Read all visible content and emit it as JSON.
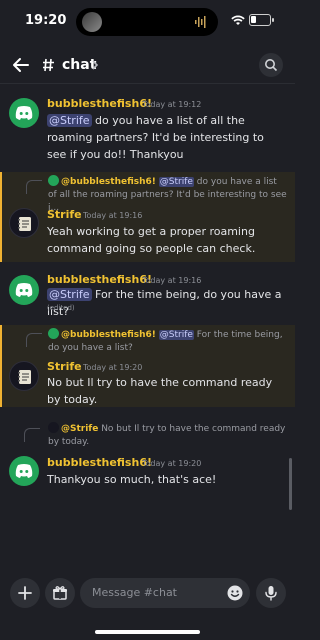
{
  "status": {
    "time": "19:20"
  },
  "header": {
    "channel": "chat"
  },
  "messages": [
    {
      "author": "bubblesthefish6!",
      "time": "Today at 19:12",
      "mention": "@Strife",
      "text": " do you have a list of all the roaming partners? It'd be interesting to see if you do!! Thankyou"
    },
    {
      "reply_author": "@bubblesthefish6!",
      "reply_mention": "@Strife",
      "reply_text": " do you have a list of all the roaming partners? It'd be interesting to see i...",
      "author": "Strife",
      "time": "Today at 19:16",
      "text": "Yeah working to get a proper roaming command going so people can check."
    },
    {
      "author": "bubblesthefish6!",
      "time": "Today at 19:16",
      "mention": "@Strife",
      "text": " For the time being, do you have a list?",
      "edited": "(edited)"
    },
    {
      "reply_author": "@bubblesthefish6!",
      "reply_mention": "@Strife",
      "reply_text": " For the time being, do you have a list?",
      "author": "Strife",
      "time": "Today at 19:20",
      "text": "No but Il try to have the command ready by today."
    },
    {
      "reply_author": "@Strife",
      "reply_text": " No but Il try to have the command ready by today.",
      "author": "bubblesthefish6!",
      "time": "Today at 19:20",
      "text": "Thankyou so much, that's ace!"
    }
  ],
  "composer": {
    "placeholder": "Message #chat"
  },
  "colors": {
    "accent_name": "#f0c232",
    "mention_bg": "#3c4270",
    "highlight_bg": "#2a2820",
    "discord_green": "#23a559"
  }
}
